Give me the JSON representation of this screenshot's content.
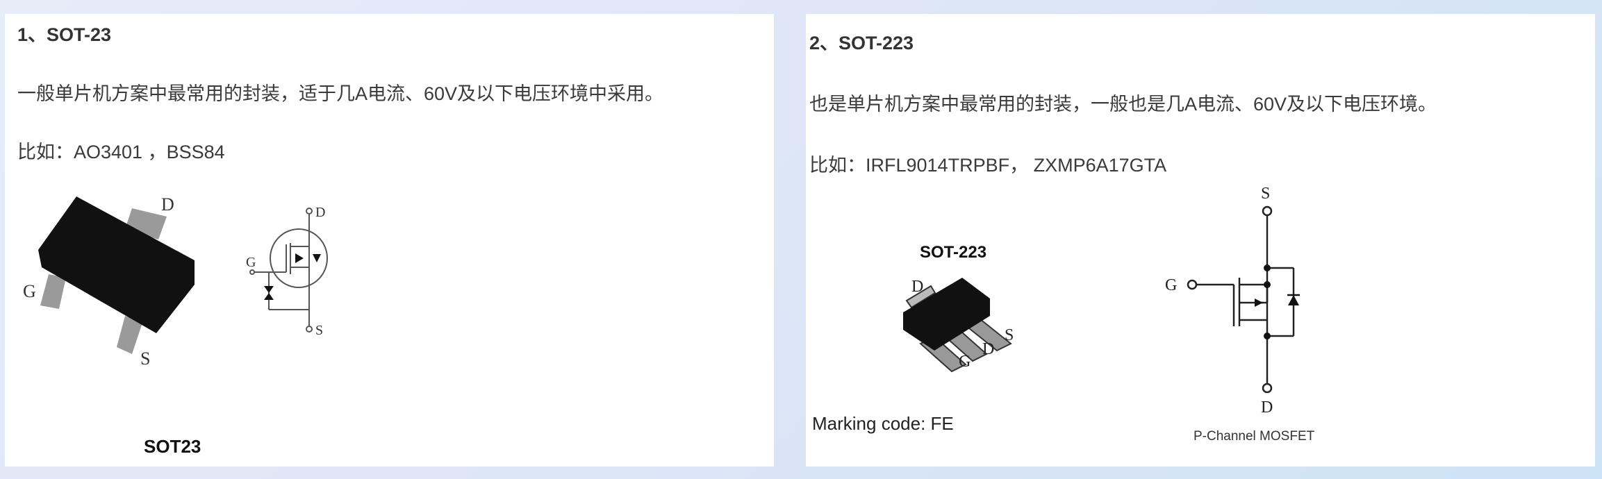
{
  "sections": [
    {
      "title": "1、SOT-23",
      "description": "一般单片机方案中最常用的封装，适于几A电流、60V及以下电压环境中采用。",
      "example": "比如：AO3401 ，BSS84",
      "package_label": "SOT23",
      "pins": {
        "d": "D",
        "g": "G",
        "s": "S"
      }
    },
    {
      "title": "2、SOT-223",
      "description": "也是单片机方案中最常用的封装，一般也是几A电流、60V及以下电压环境。",
      "example": "比如：IRFL9014TRPBF， ZXMP6A17GTA",
      "package_label": "SOT-223",
      "marking_code": "Marking code: FE",
      "schematic_caption": "P-Channel MOSFET",
      "pins": {
        "d": "D",
        "g": "G",
        "s": "S"
      }
    }
  ]
}
